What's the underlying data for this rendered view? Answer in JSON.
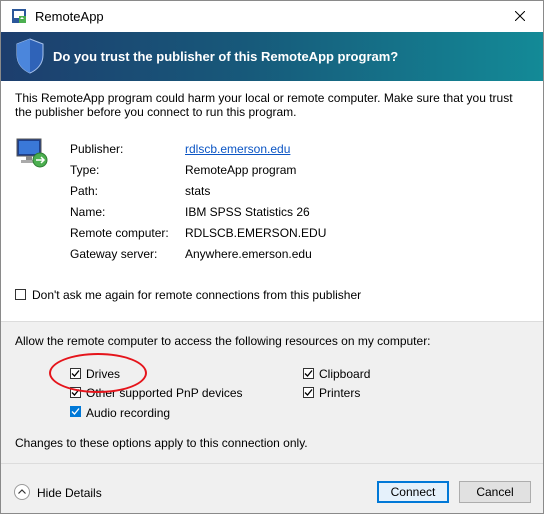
{
  "window": {
    "title": "RemoteApp"
  },
  "banner": {
    "text": "Do you trust the publisher of this RemoteApp program?"
  },
  "warning": "This RemoteApp program could harm your local or remote computer. Make sure that you trust the publisher before you connect to run this program.",
  "details": [
    {
      "label": "Publisher:",
      "value": "rdlscb.emerson.edu",
      "link": true
    },
    {
      "label": "Type:",
      "value": "RemoteApp program"
    },
    {
      "label": "Path:",
      "value": "stats"
    },
    {
      "label": "Name:",
      "value": "IBM SPSS Statistics 26"
    },
    {
      "label": "Remote computer:",
      "value": "RDLSCB.EMERSON.EDU"
    },
    {
      "label": "Gateway server:",
      "value": "Anywhere.emerson.edu"
    }
  ],
  "dont_ask": {
    "label": "Don't ask me again for remote connections from this publisher",
    "checked": false
  },
  "resources": {
    "heading": "Allow the remote computer to access the following resources on my computer:",
    "items": [
      {
        "label": "Drives",
        "checked": true
      },
      {
        "label": "Other supported PnP devices",
        "checked": true
      },
      {
        "label": "Audio recording",
        "checked": true
      },
      {
        "label": "Clipboard",
        "checked": true
      },
      {
        "label": "Printers",
        "checked": true
      }
    ]
  },
  "changes_note": "Changes to these options apply to this connection only.",
  "footer": {
    "hide_details": "Hide Details",
    "connect": "Connect",
    "cancel": "Cancel"
  },
  "colors": {
    "banner_start": "#1d3e6e",
    "banner_end": "#138a97",
    "highlight_ellipse": "#e5141b",
    "link": "#0b55c4"
  },
  "icons": {
    "app": "remoteapp-icon",
    "shield": "shield-icon",
    "computer": "remote-computer-icon",
    "close": "close-icon",
    "collapse": "chevron-up-icon"
  }
}
